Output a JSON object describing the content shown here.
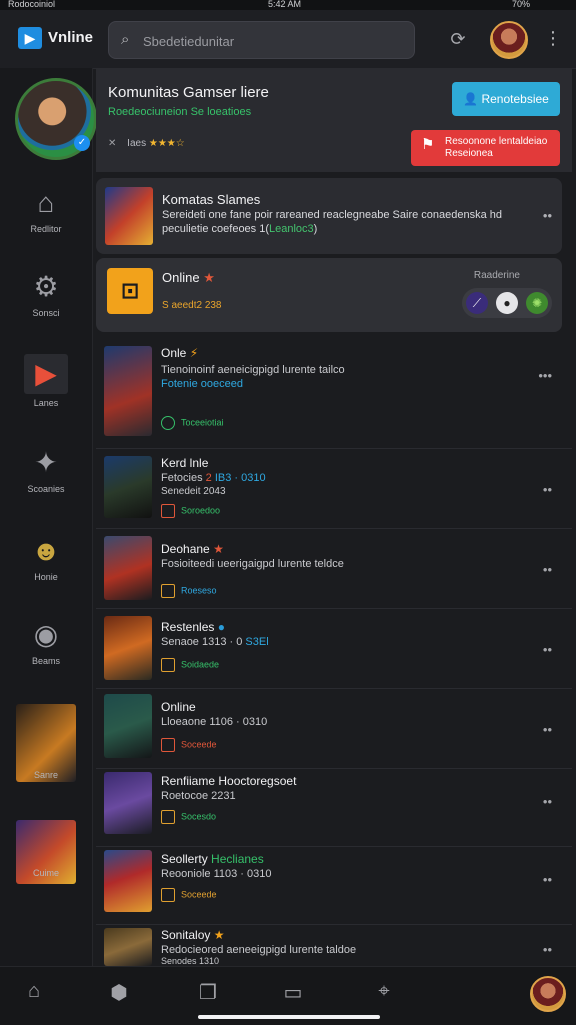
{
  "statusbar": {
    "left": "Rodocoiniol",
    "time": "5:42 AM",
    "battery": "70%"
  },
  "topbar": {
    "brand": "Vnline",
    "search_placeholder": "Sbedetiedunitar",
    "icons": {
      "logo": "play-logo-icon",
      "search": "search-icon",
      "refresh": "refresh-icon",
      "more": "kebab-menu-icon"
    }
  },
  "sidebar": {
    "items": [
      {
        "label": "Redlitor",
        "icon": "home-icon"
      },
      {
        "label": "Sonsci",
        "icon": "settings-icon"
      },
      {
        "label": "Lanes",
        "icon": "play-icon"
      },
      {
        "label": "Scoanies",
        "icon": "chat-icon"
      },
      {
        "label": "Honie",
        "icon": "controller-icon"
      },
      {
        "label": "Beams",
        "icon": "chat-bubble-icon"
      },
      {
        "label": "Sanre",
        "icon": "game-thumbnail"
      },
      {
        "label": "Cuime",
        "icon": "game-thumbnail"
      }
    ]
  },
  "header": {
    "title": "Komunitas Gamser liere",
    "subtitle": "Roedeociuneion Se loeatioes",
    "meta": "Iaes",
    "meta_stars": "★★★☆",
    "primary_button": "Renotebsiee",
    "danger_button_line1": "Resoonone lentaldeiao",
    "danger_button_line2": "Reseionea"
  },
  "feature": {
    "title": "Komatas Slames",
    "desc_line1": "Sereideti one fane poir rareaned reaclegneabe Saire conaedenska hd",
    "desc_line2": "peculietie coefeoes 1(",
    "desc_highlight": "Leanloc3",
    "desc_end": ")"
  },
  "online": {
    "title": "Online",
    "meta": "S aeedt2 238",
    "label": "Raaderine",
    "icon": "tv-icon"
  },
  "rows": [
    {
      "title": "Onle",
      "title_mark": "⚡",
      "mark_type": "st",
      "line1": "Tienoinoinf aeneicigpigd lurente tailco",
      "line2": "Fotenie ooeceed",
      "tag": "Toceeiotiai"
    },
    {
      "title": "Kerd lnle",
      "title_mark": "",
      "mark_type": "",
      "line1": "Fetocies",
      "line1_a": "2",
      "line1_b": "IB3 · 0310",
      "line2": "Senedeit 2043",
      "tag": "Soroedoo"
    },
    {
      "title": "Deohane",
      "title_mark": "★",
      "mark_type": "b",
      "line1": "Fosioiteedi ueerigaigpd lurente teldce",
      "line2": "",
      "tag": "Roeseso"
    },
    {
      "title": "Restenles",
      "title_mark": "●",
      "mark_type": "vb",
      "line1": "Senaoe 1313 · 0",
      "line1_a": "1313",
      "line1_b": "S3El",
      "line2": "",
      "tag": "Soidaede"
    },
    {
      "title": "Online",
      "title_mark": "",
      "mark_type": "",
      "line1": "Lloeaone 1106 · 0310",
      "line1_a": "",
      "line1_b": "",
      "line2": "",
      "tag": "Soceede"
    },
    {
      "title": "Renfiiame Hooctoregsoet",
      "title_mark": "",
      "mark_type": "",
      "line1": "Roetocoe 2231",
      "line1_a": "",
      "line1_b": "",
      "line2": "",
      "tag": "Socesdo"
    },
    {
      "title": "Seollerty",
      "title_mark": "Heclianes",
      "mark_type": "gr",
      "line1": "Reooniole 1103 · 0310",
      "line1_a": "",
      "line1_b": "",
      "line2": "",
      "tag": "Soceede"
    },
    {
      "title": "Sonitaloy",
      "title_mark": "★",
      "mark_type": "st",
      "line1": "Redocieored aeneeigpigd lurente taldoe",
      "line1_a": "",
      "line1_b": "",
      "line2": "Senodes 1310",
      "tag": ""
    }
  ],
  "bottom_nav": {
    "items": [
      "home-icon",
      "shield-icon",
      "cards-icon",
      "monitor-icon",
      "pin-icon"
    ]
  },
  "colors": {
    "accent_blue": "#2eaad6",
    "danger": "#e23a3a",
    "green": "#36c06a",
    "orange": "#f2a21b"
  }
}
